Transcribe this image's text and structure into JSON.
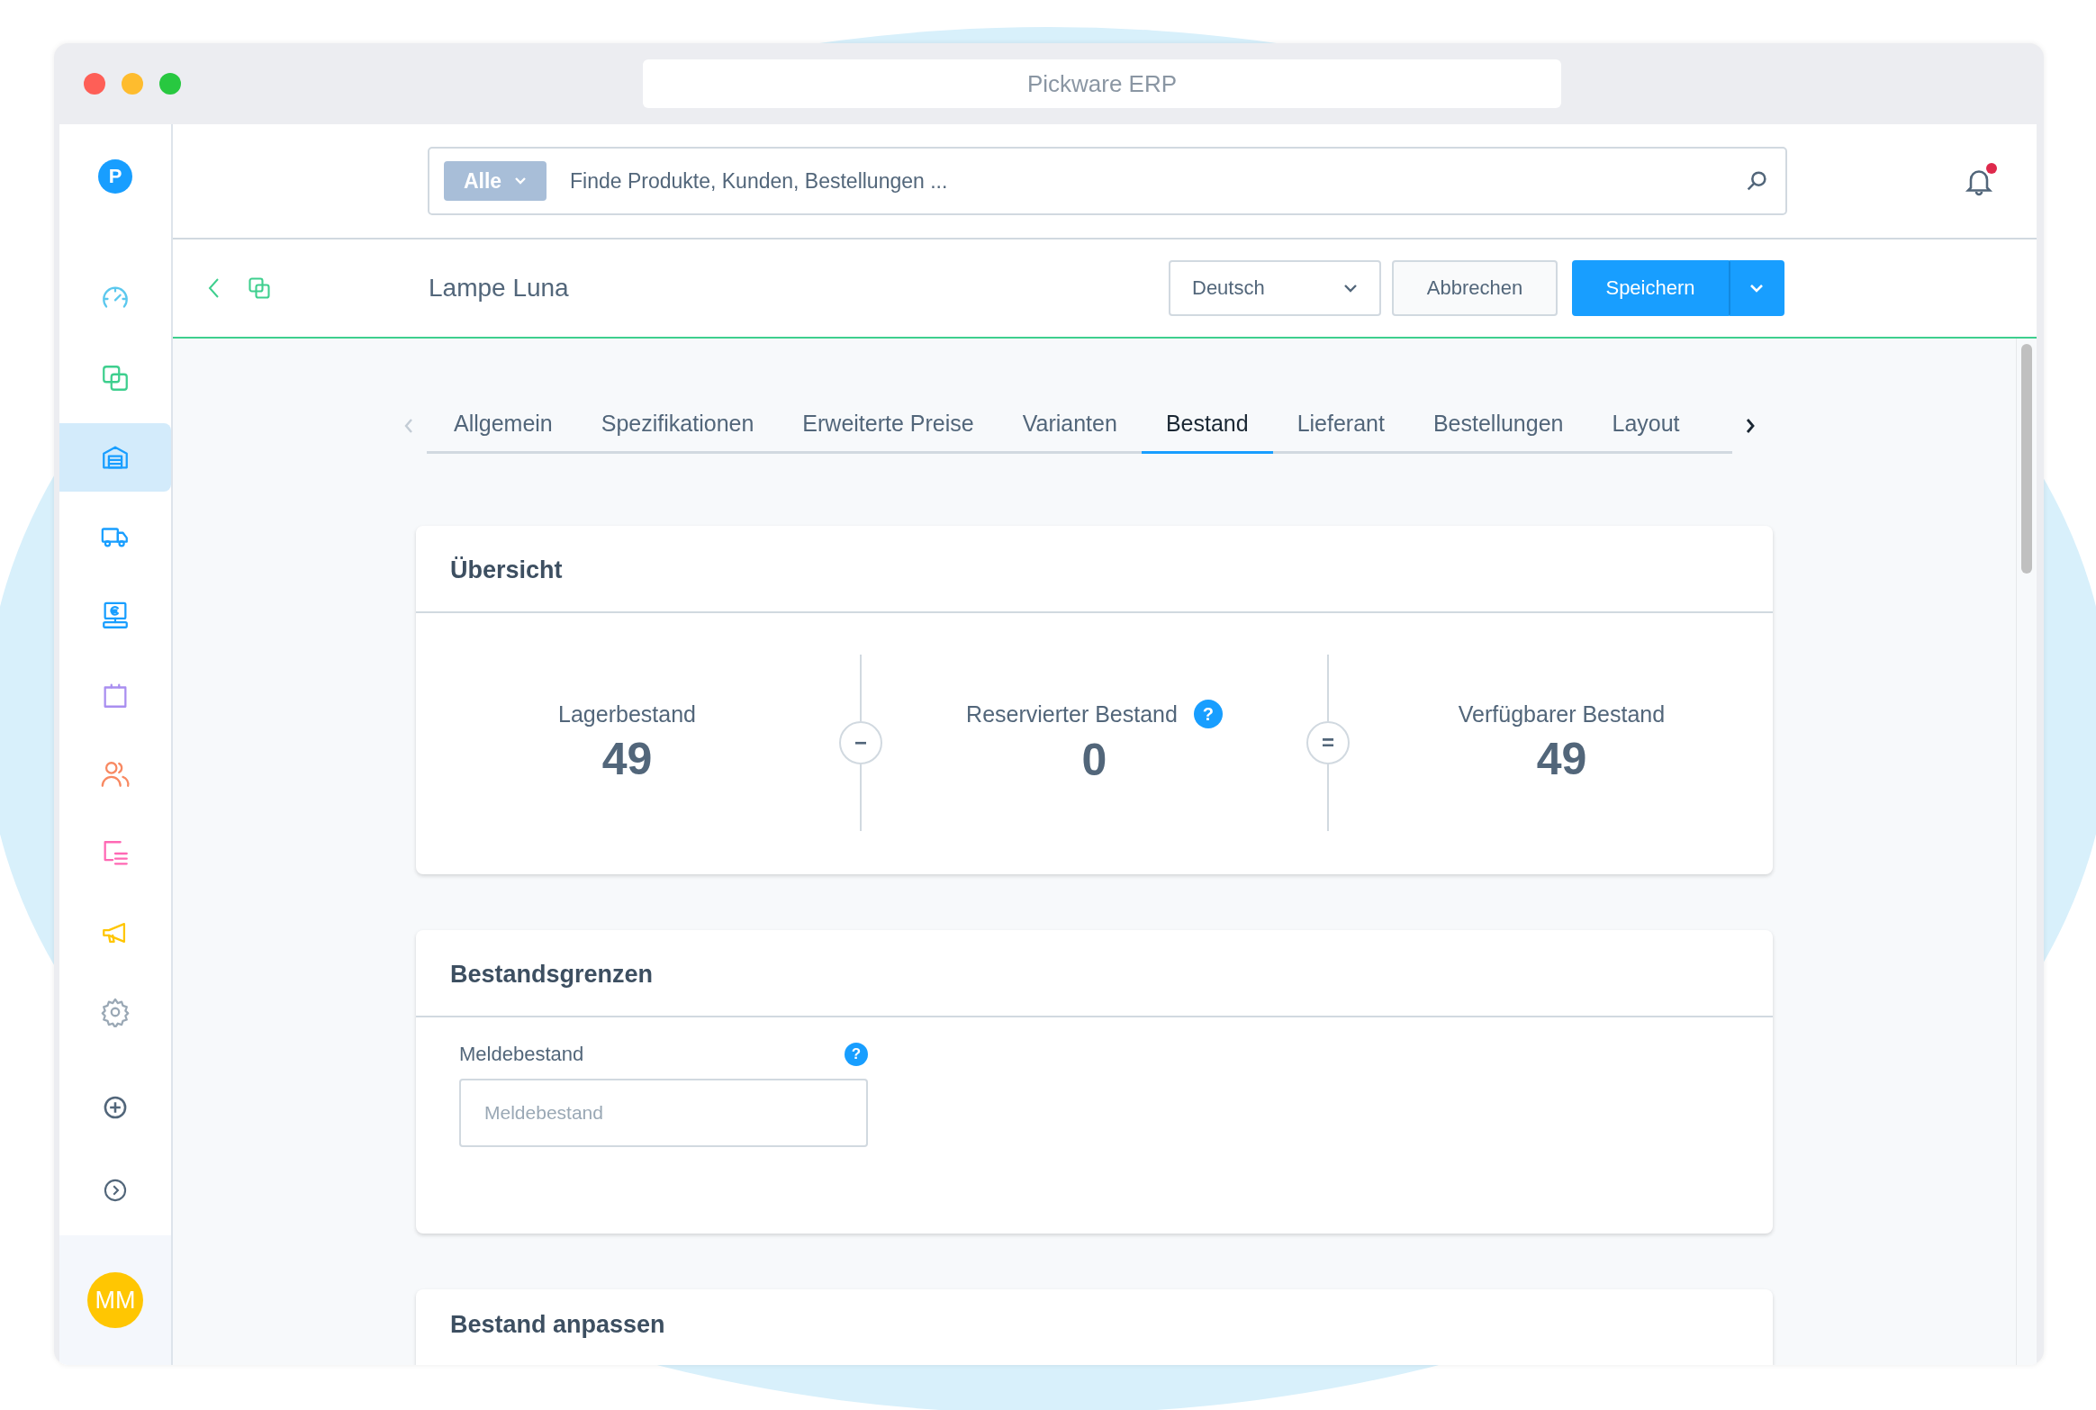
{
  "window": {
    "title": "Pickware ERP"
  },
  "sidebar": {
    "logo": "P",
    "items": [
      {
        "kind": "gauge",
        "color": "#5bc8ee",
        "selected": false
      },
      {
        "kind": "copy",
        "color": "#3ecf8e",
        "selected": false
      },
      {
        "kind": "warehouse",
        "color": "#189eff",
        "selected": true
      },
      {
        "kind": "truck",
        "color": "#189eff",
        "selected": false
      },
      {
        "kind": "register",
        "color": "#189eff",
        "selected": false
      },
      {
        "kind": "bag",
        "color": "#a98ef0",
        "selected": false
      },
      {
        "kind": "users",
        "color": "#f88962",
        "selected": false
      },
      {
        "kind": "list",
        "color": "#ff68b4",
        "selected": false
      },
      {
        "kind": "megaphone",
        "color": "#ffc602",
        "selected": false
      },
      {
        "kind": "gear",
        "color": "#9aa8b5",
        "selected": false
      }
    ],
    "actions": [
      {
        "kind": "add"
      },
      {
        "kind": "expand"
      }
    ],
    "avatar": "MM"
  },
  "search": {
    "scope": "Alle",
    "placeholder": "Finde Produkte, Kunden, Bestellungen ..."
  },
  "notifications": {
    "unread": true
  },
  "header": {
    "title": "Lampe Luna",
    "language": "Deutsch",
    "buttons": [
      {
        "label": "Abbrechen",
        "kind": "secondary"
      },
      {
        "label": "Speichern",
        "kind": "primary"
      }
    ]
  },
  "tab_scroll": {
    "prev_disabled": true,
    "next_disabled": false
  },
  "tabs": [
    {
      "label": "Allgemein",
      "selected": false
    },
    {
      "label": "Spezifikationen",
      "selected": false
    },
    {
      "label": "Erweiterte Preise",
      "selected": false
    },
    {
      "label": "Varianten",
      "selected": false
    },
    {
      "label": "Bestand",
      "selected": true
    },
    {
      "label": "Lieferant",
      "selected": false
    },
    {
      "label": "Bestellungen",
      "selected": false
    },
    {
      "label": "Layout",
      "selected": false
    }
  ],
  "overview": {
    "title": "Übersicht",
    "metrics": [
      {
        "label": "Lagerbestand",
        "value": "49"
      },
      {
        "label": "Reservierter Bestand",
        "value": "0",
        "help": "?"
      },
      {
        "label": "Verfügbarer Bestand",
        "value": "49"
      }
    ],
    "operators": [
      "−",
      "="
    ]
  },
  "limits": {
    "title": "Bestandsgrenzen",
    "fields": [
      {
        "label": "Meldebestand",
        "placeholder": "Meldebestand",
        "help": "?"
      }
    ]
  },
  "adjust": {
    "title": "Bestand anpassen"
  }
}
